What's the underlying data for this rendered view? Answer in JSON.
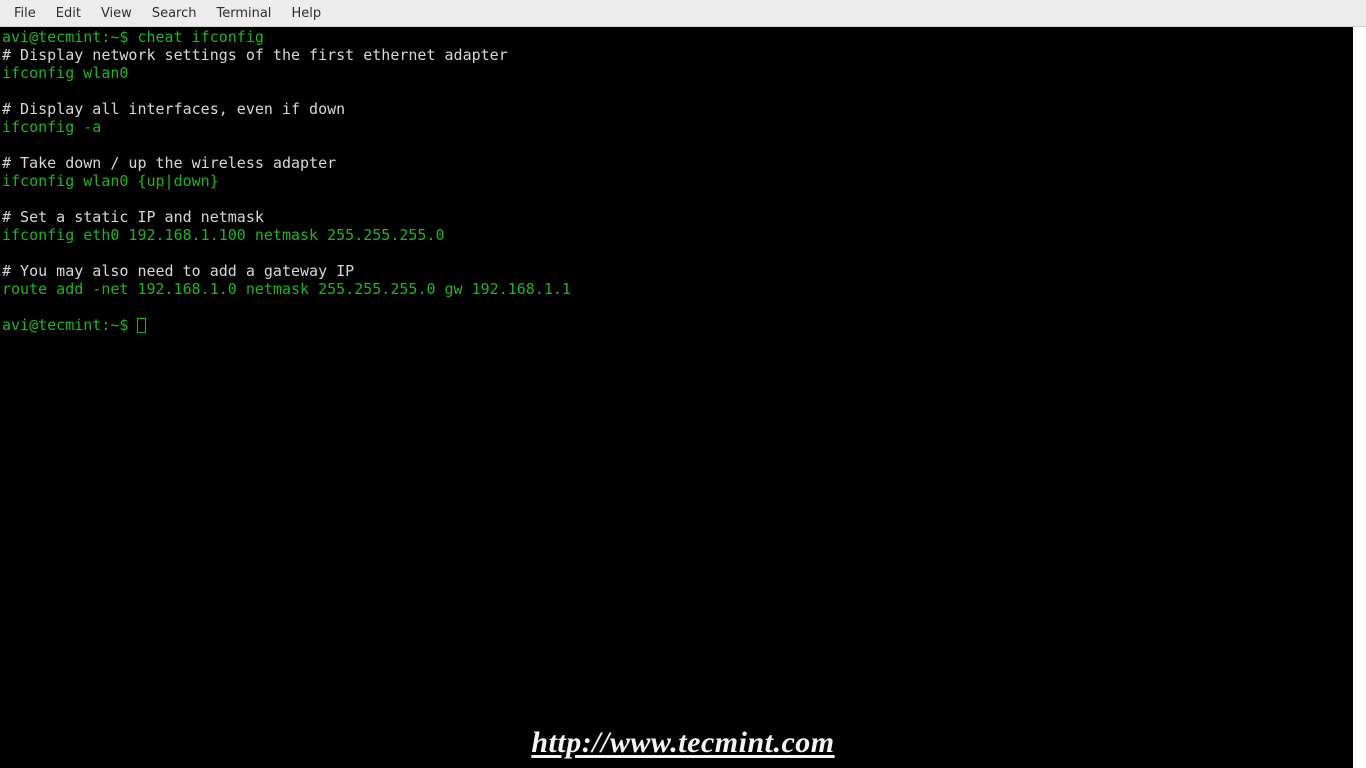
{
  "menubar": {
    "items": [
      "File",
      "Edit",
      "View",
      "Search",
      "Terminal",
      "Help"
    ]
  },
  "terminal": {
    "lines": [
      {
        "segments": [
          {
            "cls": "prompt",
            "text": "avi@tecmint:~$ "
          },
          {
            "cls": "cmd-green",
            "text": "cheat ifconfig"
          }
        ]
      },
      {
        "segments": [
          {
            "cls": "comment",
            "text": "# Display network settings of the first ethernet adapter"
          }
        ]
      },
      {
        "segments": [
          {
            "cls": "cmd-green",
            "text": "ifconfig wlan0"
          }
        ]
      },
      {
        "segments": [
          {
            "cls": "",
            "text": " "
          }
        ]
      },
      {
        "segments": [
          {
            "cls": "comment",
            "text": "# Display all interfaces, even if down"
          }
        ]
      },
      {
        "segments": [
          {
            "cls": "cmd-green",
            "text": "ifconfig -a"
          }
        ]
      },
      {
        "segments": [
          {
            "cls": "",
            "text": " "
          }
        ]
      },
      {
        "segments": [
          {
            "cls": "comment",
            "text": "# Take down / up the wireless adapter"
          }
        ]
      },
      {
        "segments": [
          {
            "cls": "cmd-green",
            "text": "ifconfig wlan0 {up|down}"
          }
        ]
      },
      {
        "segments": [
          {
            "cls": "",
            "text": " "
          }
        ]
      },
      {
        "segments": [
          {
            "cls": "comment",
            "text": "# Set a static IP and netmask"
          }
        ]
      },
      {
        "segments": [
          {
            "cls": "cmd-green",
            "text": "ifconfig eth0 192.168.1.100 netmask 255.255.255.0"
          }
        ]
      },
      {
        "segments": [
          {
            "cls": "",
            "text": " "
          }
        ]
      },
      {
        "segments": [
          {
            "cls": "comment",
            "text": "# You may also need to add a gateway IP"
          }
        ]
      },
      {
        "segments": [
          {
            "cls": "cmd-green",
            "text": "route add -net 192.168.1.0 netmask 255.255.255.0 gw 192.168.1.1"
          }
        ]
      },
      {
        "segments": [
          {
            "cls": "",
            "text": " "
          }
        ]
      },
      {
        "segments": [
          {
            "cls": "prompt",
            "text": "avi@tecmint:~$ "
          }
        ],
        "cursor": true
      }
    ]
  },
  "watermark": "http://www.tecmint.com"
}
